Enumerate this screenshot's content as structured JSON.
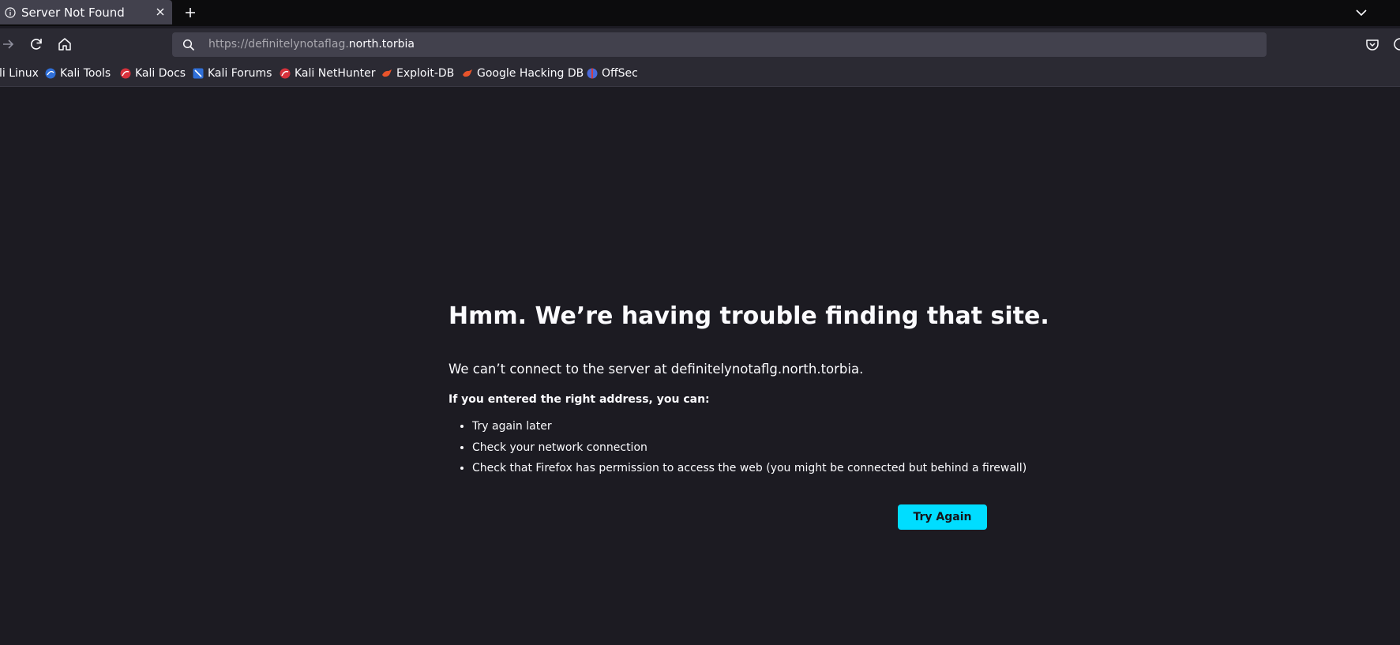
{
  "tab": {
    "title": "Server Not Found",
    "icon": "info-icon"
  },
  "toolbar": {
    "url_scheme_path": "https://definitelynotaflag.",
    "url_host": "north.torbia"
  },
  "bookmarks": [
    {
      "label": "li Linux",
      "icon": "kali-icon",
      "color": "#2f6fd8"
    },
    {
      "label": "Kali Tools",
      "icon": "kali-tools-icon",
      "color": "#2f6fd8"
    },
    {
      "label": "Kali Docs",
      "icon": "kali-docs-icon",
      "color": "#d8323c"
    },
    {
      "label": "Kali Forums",
      "icon": "kali-forums-icon",
      "color": "#2f6fd8"
    },
    {
      "label": "Kali NetHunter",
      "icon": "kali-nethunter-icon",
      "color": "#d8323c"
    },
    {
      "label": "Exploit-DB",
      "icon": "exploit-db-icon",
      "color": "#e8542b"
    },
    {
      "label": "Google Hacking DB",
      "icon": "ghdb-icon",
      "color": "#e8542b"
    },
    {
      "label": "OffSec",
      "icon": "offsec-icon",
      "color": "#4b6bdc"
    }
  ],
  "error": {
    "title": "Hmm. We’re having trouble finding that site.",
    "description": "We can’t connect to the server at definitelynotaflg.north.torbia.",
    "subheading": "If you entered the right address, you can:",
    "suggestions": [
      "Try again later",
      "Check your network connection",
      "Check that Firefox has permission to access the web (you might be connected but behind a firewall)"
    ],
    "button_label": "Try Again"
  },
  "colors": {
    "accent": "#00ddff",
    "page_bg": "#1c1b22",
    "toolbar_bg": "#2b2a33"
  }
}
